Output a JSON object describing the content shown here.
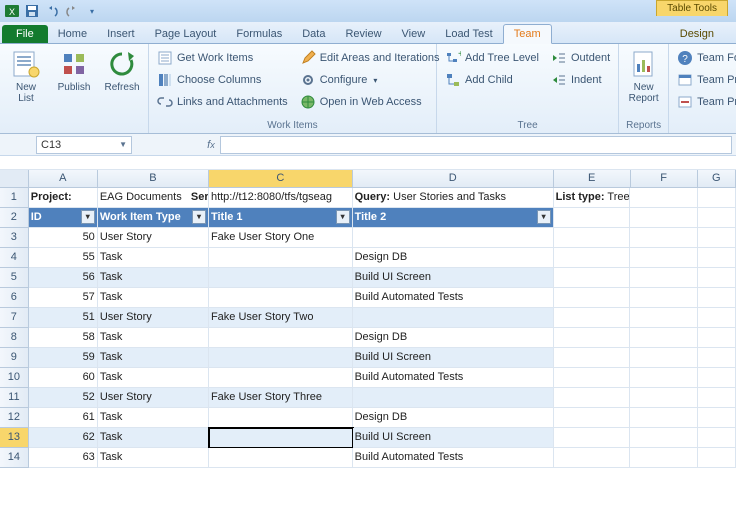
{
  "qat": {
    "tooltip": "Quick Access Toolbar"
  },
  "tabletools": {
    "title": "Table Tools",
    "design": "Design"
  },
  "tabs": {
    "file": "File",
    "items": [
      "Home",
      "Insert",
      "Page Layout",
      "Formulas",
      "Data",
      "Review",
      "View",
      "Load Test",
      "Team"
    ]
  },
  "ribbon": {
    "big": {
      "newlist": "New List",
      "publish": "Publish",
      "refresh": "Refresh",
      "newreport": "New Report"
    },
    "workitems": {
      "get": "Get Work Items",
      "choose": "Choose Columns",
      "links": "Links and Attachments",
      "edit": "Edit Areas and Iterations",
      "configure": "Configure",
      "open": "Open in Web Access",
      "label": "Work Items"
    },
    "tree": {
      "addlevel": "Add Tree Level",
      "addchild": "Add Child",
      "outdent": "Outdent",
      "indent": "Indent",
      "label": "Tree"
    },
    "reports": {
      "label": "Reports"
    },
    "links": {
      "teamfo": "Team Fo",
      "teampr1": "Team Pr",
      "teampr2": "Team Pr"
    }
  },
  "namebox": "C13",
  "row1": {
    "project_l": "Project:",
    "project_v": "EAG Documents",
    "server_l": "Server:",
    "server_v": "http://t12:8080/tfs/tgseag",
    "query_l": "Query:",
    "query_v": "User Stories and Tasks",
    "list_l": "List type:",
    "list_v": "Tree"
  },
  "headers": {
    "id": "ID",
    "wit": "Work Item Type",
    "t1": "Title 1",
    "t2": "Title 2"
  },
  "rows": [
    {
      "n": 3,
      "id": "50",
      "wit": "User Story",
      "t1": "Fake User Story One",
      "t2": ""
    },
    {
      "n": 4,
      "id": "55",
      "wit": "Task",
      "t1": "",
      "t2": "Design DB"
    },
    {
      "n": 5,
      "id": "56",
      "wit": "Task",
      "t1": "",
      "t2": "Build UI Screen"
    },
    {
      "n": 6,
      "id": "57",
      "wit": "Task",
      "t1": "",
      "t2": "Build Automated Tests"
    },
    {
      "n": 7,
      "id": "51",
      "wit": "User Story",
      "t1": "Fake User Story Two",
      "t2": ""
    },
    {
      "n": 8,
      "id": "58",
      "wit": "Task",
      "t1": "",
      "t2": "Design DB"
    },
    {
      "n": 9,
      "id": "59",
      "wit": "Task",
      "t1": "",
      "t2": "Build UI Screen"
    },
    {
      "n": 10,
      "id": "60",
      "wit": "Task",
      "t1": "",
      "t2": "Build Automated Tests"
    },
    {
      "n": 11,
      "id": "52",
      "wit": "User Story",
      "t1": "Fake User Story Three",
      "t2": ""
    },
    {
      "n": 12,
      "id": "61",
      "wit": "Task",
      "t1": "",
      "t2": "Design DB"
    },
    {
      "n": 13,
      "id": "62",
      "wit": "Task",
      "t1": "",
      "t2": "Build UI Screen"
    },
    {
      "n": 14,
      "id": "63",
      "wit": "Task",
      "t1": "",
      "t2": "Build Automated Tests"
    }
  ]
}
